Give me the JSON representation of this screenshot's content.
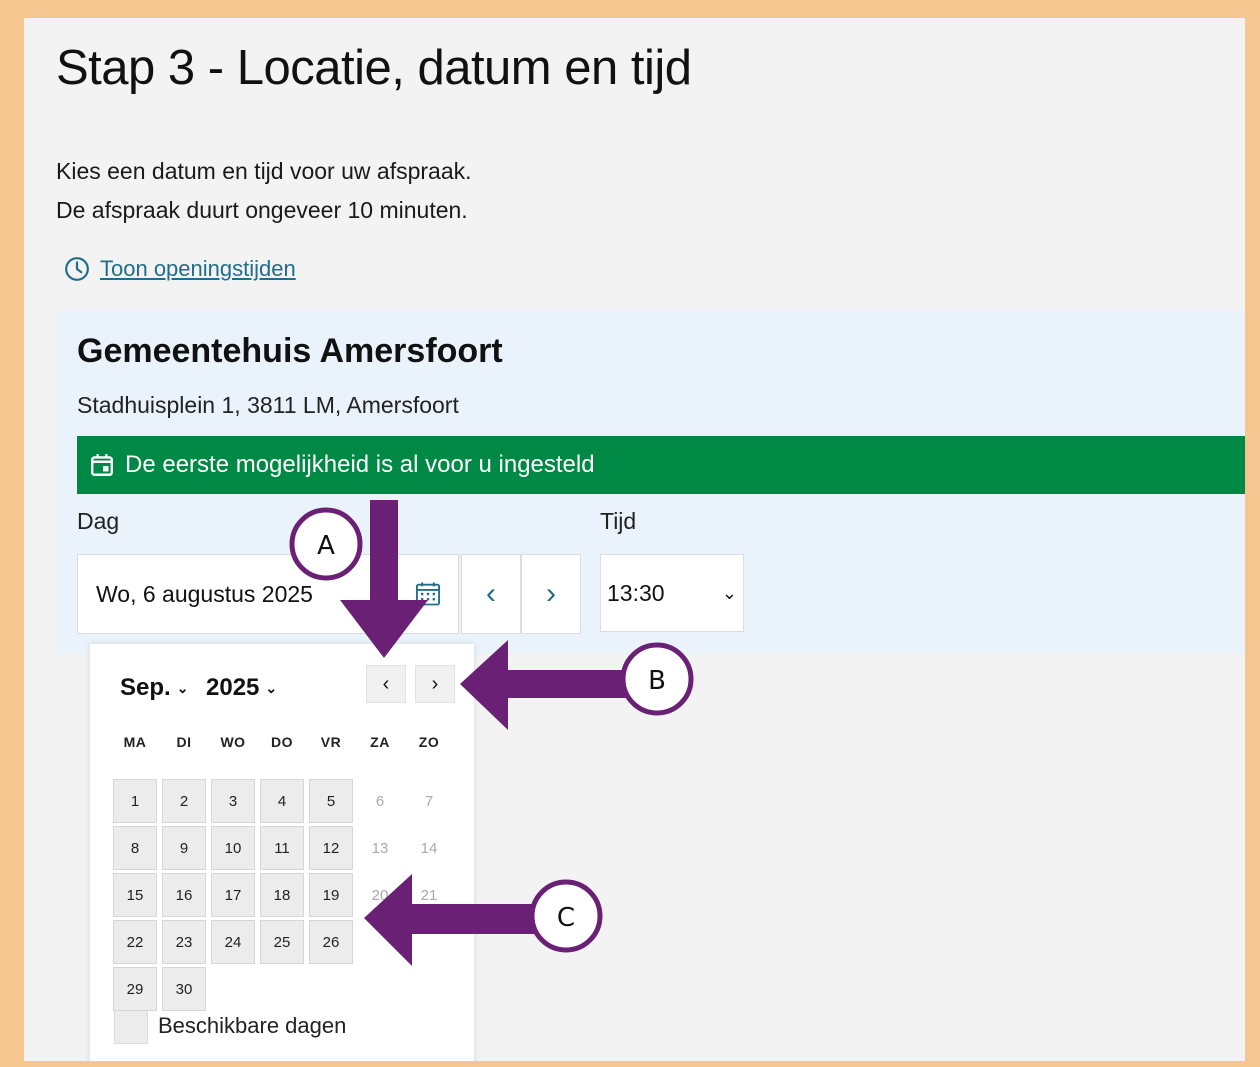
{
  "header": {
    "title": "Stap 3 - Locatie, datum en tijd"
  },
  "intro": {
    "line1": "Kies een datum en tijd voor uw afspraak.",
    "line2": "De afspraak duurt ongeveer 10 minuten."
  },
  "hours_link": {
    "label": "Toon openingstijden",
    "icon": "clock-icon"
  },
  "location": {
    "name": "Gemeentehuis Amersfoort",
    "address": "Stadhuisplein 1, 3811 LM, Amersfoort",
    "banner": "De eerste mogelijkheid is al voor u ingesteld"
  },
  "form": {
    "day_label": "Dag",
    "day_value": "Wo, 6 augustus 2025",
    "time_label": "Tijd",
    "time_value": "13:30",
    "prev_day": "‹",
    "next_day": "›"
  },
  "calendar": {
    "month": "Sep.",
    "year": "2025",
    "prev": "‹",
    "next": "›",
    "weekdays": [
      "MA",
      "DI",
      "WO",
      "DO",
      "VR",
      "ZA",
      "ZO"
    ],
    "weeks": [
      [
        1,
        2,
        3,
        4,
        5,
        6,
        7
      ],
      [
        8,
        9,
        10,
        11,
        12,
        13,
        14
      ],
      [
        15,
        16,
        17,
        18,
        19,
        20,
        21
      ],
      [
        22,
        23,
        24,
        25,
        26,
        null,
        null
      ],
      [
        29,
        30,
        null,
        null,
        null,
        null,
        null
      ]
    ],
    "unavailable": [
      6,
      7,
      13,
      14,
      20,
      21
    ],
    "legend": "Beschikbare dagen"
  },
  "annotations": {
    "a": "A",
    "b": "B",
    "c": "C"
  },
  "colors": {
    "frame": "#f5c68f",
    "banner": "#008944",
    "link": "#1e6e8c",
    "panel": "#eaf3fb",
    "arrow": "#6a2175"
  }
}
